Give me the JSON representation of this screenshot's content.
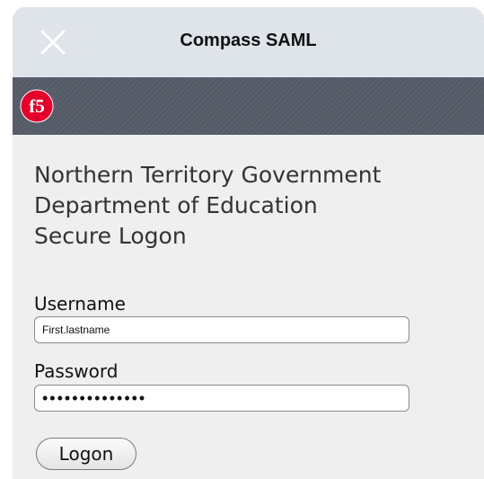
{
  "nav": {
    "title": "Compass SAML",
    "close_icon": "close-icon"
  },
  "banner": {
    "logo_text": "f5",
    "logo_color": "#e4002b",
    "background": "#545a66"
  },
  "heading": {
    "line1": "Northern Territory Government",
    "line2": "Department of Education",
    "line3": "Secure Logon"
  },
  "form": {
    "username_label": "Username",
    "username_value": "First.lastname",
    "password_label": "Password",
    "password_value": "••••••••••••••",
    "logon_label": "Logon"
  }
}
